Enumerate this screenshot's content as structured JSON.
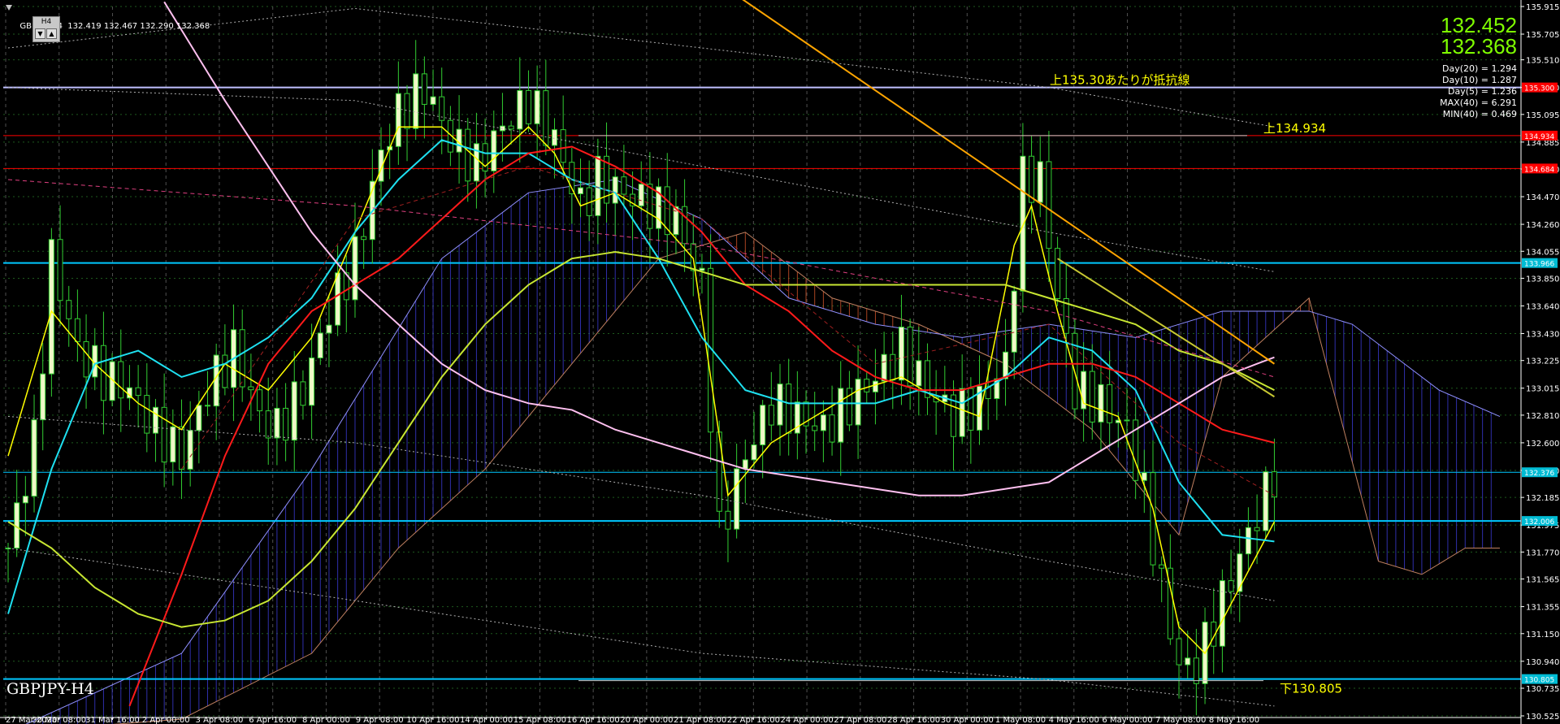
{
  "header": {
    "symbol_info": "GBPJPY,H4  132.419 132.467 132.290 132.368",
    "timeframe": "H4",
    "up_button": "▼",
    "down_button": "▲"
  },
  "price_display": {
    "bid": "132.452",
    "ask": "132.368"
  },
  "stats": [
    "Day(20) = 1.294",
    "Day(10) = 1.287",
    "Day(5) = 1.236",
    "MAX(40) = 6.291",
    "MIN(40) = 0.469"
  ],
  "symbol_label": "GBPJPY-H4",
  "annotations": [
    {
      "text": "上135.30あたりが抵抗線",
      "price": 135.3
    },
    {
      "text": "上134.934",
      "price": 134.934
    },
    {
      "text": "下130.805",
      "price": 130.805
    }
  ],
  "colors": {
    "background": "#000000",
    "candle_body": "#f0f8c8",
    "wick": "#32cd32",
    "annotation": "#ffff00",
    "price_text": "#7fff00",
    "ma_red": "#ff1a1a",
    "ma_cyan": "#1ee0f0",
    "ma_yellow": "#ffff00",
    "ma_yellowgreen": "#c8e632",
    "ma_pink": "#ffc0f0",
    "trend_orange": "#ffa500",
    "level_cyan": "#00c8ff",
    "level_red": "#ff0000",
    "cloud_blue": "#3838c8",
    "cloud_red": "#c85028"
  },
  "chart_data": {
    "type": "candlestick",
    "y_ticks": [
      "135.915",
      "135.705",
      "135.510",
      "135.300",
      "135.095",
      "134.885",
      "134.680",
      "134.470",
      "134.260",
      "134.055",
      "133.850",
      "133.640",
      "133.430",
      "133.225",
      "133.015",
      "132.810",
      "132.600",
      "132.390",
      "132.185",
      "131.975",
      "131.770",
      "131.565",
      "131.355",
      "131.150",
      "130.940",
      "130.735",
      "130.525"
    ],
    "ylim": [
      130.525,
      135.915
    ],
    "x_ticks": [
      "27 Mar 2020",
      "30 Mar 08:00",
      "31 Mar 16:00",
      "2 Apr 00:00",
      "3 Apr 08:00",
      "6 Apr 16:00",
      "8 Apr 00:00",
      "9 Apr 08:00",
      "10 Apr 16:00",
      "14 Apr 00:00",
      "15 Apr 08:00",
      "16 Apr 16:00",
      "20 Apr 00:00",
      "21 Apr 08:00",
      "22 Apr 16:00",
      "24 Apr 00:00",
      "27 Apr 08:00",
      "28 Apr 16:00",
      "30 Apr 00:00",
      "1 May 08:00",
      "4 May 16:00",
      "6 May 00:00",
      "7 May 08:00",
      "8 May 16:00"
    ],
    "right_tags": [
      {
        "label": "135.300",
        "price": 135.3,
        "color": "#ff0000"
      },
      {
        "label": "134.934",
        "price": 134.934,
        "color": "#ff0000"
      },
      {
        "label": "134.684",
        "price": 134.684,
        "color": "#ff0000"
      },
      {
        "label": "133.966",
        "price": 133.966,
        "color": "#00bcd4"
      },
      {
        "label": "132.376",
        "price": 132.376,
        "color": "#00bcd4"
      },
      {
        "label": "132.006",
        "price": 132.006,
        "color": "#00bcd4"
      },
      {
        "label": "130.805",
        "price": 130.805,
        "color": "#00bcd4"
      }
    ],
    "horizontal_levels": [
      {
        "price": 135.3,
        "color": "#c0c0ff",
        "width": 2
      },
      {
        "price": 134.934,
        "color": "#ff0000",
        "width": 1
      },
      {
        "price": 134.684,
        "color": "#ff0000",
        "width": 1
      },
      {
        "price": 133.966,
        "color": "#00c8ff",
        "width": 2
      },
      {
        "price": 132.376,
        "color": "#00c8ff",
        "width": 1
      },
      {
        "price": 132.006,
        "color": "#00c8ff",
        "width": 2
      },
      {
        "price": 130.805,
        "color": "#00c8ff",
        "width": 2
      }
    ],
    "candle_count": 147,
    "candles_close_path": [
      [
        0,
        131.8
      ],
      [
        3,
        132.6
      ],
      [
        5,
        134.0
      ],
      [
        8,
        133.3
      ],
      [
        11,
        133.1
      ],
      [
        14,
        133.0
      ],
      [
        17,
        132.7
      ],
      [
        20,
        132.5
      ],
      [
        23,
        133.0
      ],
      [
        26,
        133.3
      ],
      [
        29,
        132.8
      ],
      [
        31,
        132.7
      ],
      [
        34,
        133.0
      ],
      [
        37,
        133.6
      ],
      [
        40,
        134.0
      ],
      [
        43,
        134.8
      ],
      [
        45,
        135.1
      ],
      [
        48,
        135.3
      ],
      [
        51,
        134.9
      ],
      [
        54,
        134.7
      ],
      [
        57,
        135.0
      ],
      [
        60,
        135.2
      ],
      [
        63,
        134.9
      ],
      [
        66,
        134.4
      ],
      [
        68,
        134.6
      ],
      [
        71,
        134.5
      ],
      [
        74,
        134.4
      ],
      [
        77,
        134.3
      ],
      [
        80,
        133.8
      ],
      [
        82,
        131.9
      ],
      [
        85,
        132.5
      ],
      [
        88,
        132.9
      ],
      [
        91,
        132.8
      ],
      [
        94,
        132.7
      ],
      [
        97,
        132.9
      ],
      [
        100,
        133.1
      ],
      [
        103,
        133.3
      ],
      [
        106,
        133.0
      ],
      [
        109,
        132.8
      ],
      [
        112,
        132.9
      ],
      [
        115,
        133.2
      ],
      [
        117,
        134.6
      ],
      [
        119,
        134.6
      ],
      [
        121,
        133.7
      ],
      [
        123,
        133.0
      ],
      [
        126,
        132.9
      ],
      [
        129,
        132.7
      ],
      [
        131,
        132.2
      ],
      [
        133,
        131.5
      ],
      [
        135,
        130.9
      ],
      [
        137,
        130.9
      ],
      [
        140,
        131.4
      ],
      [
        143,
        131.9
      ],
      [
        146,
        132.368
      ]
    ],
    "series": [
      {
        "name": "",
        "color": "#ffff00",
        "points": [
          [
            0,
            132.5
          ],
          [
            5,
            133.6
          ],
          [
            10,
            133.2
          ],
          [
            15,
            132.9
          ],
          [
            20,
            132.7
          ],
          [
            25,
            133.2
          ],
          [
            30,
            133.0
          ],
          [
            35,
            133.4
          ],
          [
            40,
            134.2
          ],
          [
            45,
            135.0
          ],
          [
            50,
            135.0
          ],
          [
            55,
            134.7
          ],
          [
            60,
            135.0
          ],
          [
            63,
            134.8
          ],
          [
            66,
            134.4
          ],
          [
            70,
            134.5
          ],
          [
            75,
            134.3
          ],
          [
            79,
            134.0
          ],
          [
            83,
            132.2
          ],
          [
            88,
            132.6
          ],
          [
            93,
            132.8
          ],
          [
            98,
            133.0
          ],
          [
            103,
            133.1
          ],
          [
            108,
            132.9
          ],
          [
            112,
            132.8
          ],
          [
            116,
            134.1
          ],
          [
            118,
            134.4
          ],
          [
            121,
            133.6
          ],
          [
            124,
            132.9
          ],
          [
            128,
            132.8
          ],
          [
            132,
            132.1
          ],
          [
            135,
            131.2
          ],
          [
            138,
            131.0
          ],
          [
            142,
            131.5
          ],
          [
            146,
            132.0
          ]
        ]
      },
      {
        "name": "",
        "color": "#1ee0f0",
        "points": [
          [
            0,
            131.3
          ],
          [
            5,
            132.4
          ],
          [
            10,
            133.2
          ],
          [
            15,
            133.3
          ],
          [
            20,
            133.1
          ],
          [
            25,
            133.2
          ],
          [
            30,
            133.4
          ],
          [
            35,
            133.7
          ],
          [
            40,
            134.2
          ],
          [
            45,
            134.6
          ],
          [
            50,
            134.9
          ],
          [
            55,
            134.8
          ],
          [
            60,
            134.8
          ],
          [
            65,
            134.6
          ],
          [
            70,
            134.5
          ],
          [
            75,
            134.0
          ],
          [
            80,
            133.4
          ],
          [
            85,
            133.0
          ],
          [
            90,
            132.9
          ],
          [
            95,
            132.9
          ],
          [
            100,
            132.9
          ],
          [
            105,
            133.0
          ],
          [
            110,
            132.9
          ],
          [
            115,
            133.1
          ],
          [
            120,
            133.4
          ],
          [
            125,
            133.3
          ],
          [
            130,
            133.0
          ],
          [
            135,
            132.3
          ],
          [
            140,
            131.9
          ],
          [
            146,
            131.85
          ]
        ]
      },
      {
        "name": "",
        "color": "#ff1a1a",
        "points": [
          [
            14,
            130.6
          ],
          [
            20,
            131.6
          ],
          [
            25,
            132.5
          ],
          [
            30,
            133.2
          ],
          [
            35,
            133.6
          ],
          [
            40,
            133.8
          ],
          [
            45,
            134.0
          ],
          [
            50,
            134.3
          ],
          [
            55,
            134.6
          ],
          [
            60,
            134.8
          ],
          [
            65,
            134.85
          ],
          [
            70,
            134.7
          ],
          [
            75,
            134.5
          ],
          [
            80,
            134.2
          ],
          [
            85,
            133.8
          ],
          [
            90,
            133.6
          ],
          [
            95,
            133.3
          ],
          [
            100,
            133.1
          ],
          [
            105,
            133.0
          ],
          [
            110,
            133.0
          ],
          [
            115,
            133.1
          ],
          [
            120,
            133.2
          ],
          [
            125,
            133.2
          ],
          [
            130,
            133.1
          ],
          [
            135,
            132.9
          ],
          [
            140,
            132.7
          ],
          [
            146,
            132.6
          ]
        ]
      },
      {
        "name": "",
        "color": "#c8e632",
        "points": [
          [
            0,
            132.0
          ],
          [
            5,
            131.8
          ],
          [
            10,
            131.5
          ],
          [
            15,
            131.3
          ],
          [
            20,
            131.2
          ],
          [
            25,
            131.25
          ],
          [
            30,
            131.4
          ],
          [
            35,
            131.7
          ],
          [
            40,
            132.1
          ],
          [
            45,
            132.6
          ],
          [
            50,
            133.1
          ],
          [
            55,
            133.5
          ],
          [
            60,
            133.8
          ],
          [
            65,
            134.0
          ],
          [
            70,
            134.05
          ],
          [
            75,
            134.0
          ],
          [
            80,
            133.9
          ],
          [
            85,
            133.8
          ],
          [
            90,
            133.8
          ],
          [
            95,
            133.8
          ],
          [
            100,
            133.8
          ],
          [
            105,
            133.8
          ],
          [
            110,
            133.8
          ],
          [
            115,
            133.8
          ],
          [
            120,
            133.7
          ],
          [
            125,
            133.6
          ],
          [
            130,
            133.5
          ],
          [
            135,
            133.3
          ],
          [
            140,
            133.2
          ],
          [
            146,
            133.0
          ]
        ]
      },
      {
        "name": "",
        "color": "#ffc0f0",
        "points": [
          [
            18,
            135.95
          ],
          [
            25,
            135.2
          ],
          [
            30,
            134.7
          ],
          [
            35,
            134.2
          ],
          [
            40,
            133.8
          ],
          [
            45,
            133.5
          ],
          [
            50,
            133.2
          ],
          [
            55,
            133.0
          ],
          [
            60,
            132.9
          ],
          [
            65,
            132.85
          ],
          [
            70,
            132.7
          ],
          [
            75,
            132.6
          ],
          [
            80,
            132.5
          ],
          [
            85,
            132.4
          ],
          [
            90,
            132.35
          ],
          [
            95,
            132.3
          ],
          [
            100,
            132.25
          ],
          [
            105,
            132.2
          ],
          [
            110,
            132.2
          ],
          [
            115,
            132.25
          ],
          [
            120,
            132.3
          ],
          [
            125,
            132.5
          ],
          [
            130,
            132.7
          ],
          [
            135,
            132.9
          ],
          [
            140,
            133.1
          ],
          [
            146,
            133.25
          ]
        ]
      }
    ],
    "trendlines": [
      {
        "color": "#ffa500",
        "from": [
          84,
          136.0
        ],
        "to": [
          146,
          133.2
        ]
      },
      {
        "color": "#c8c832",
        "from": [
          121,
          134.0
        ],
        "to": [
          146,
          132.95
        ]
      }
    ]
  }
}
